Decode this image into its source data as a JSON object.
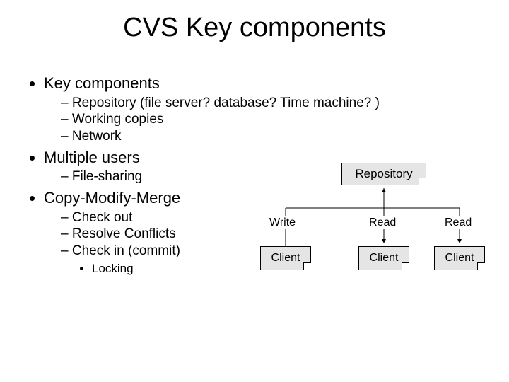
{
  "title": "CVS Key components",
  "bullets": {
    "b1": "Key components",
    "b1a": "Repository (file server? database? Time machine? )",
    "b1b": "Working copies",
    "b1c": "Network",
    "b2": "Multiple users",
    "b2a": "File-sharing",
    "b3": "Copy-Modify-Merge",
    "b3a": "Check out",
    "b3b": "Resolve Conflicts",
    "b3c": "Check in (commit)",
    "b3c1": "Locking"
  },
  "diagram": {
    "repository": "Repository",
    "client": "Client",
    "write": "Write",
    "read": "Read"
  }
}
